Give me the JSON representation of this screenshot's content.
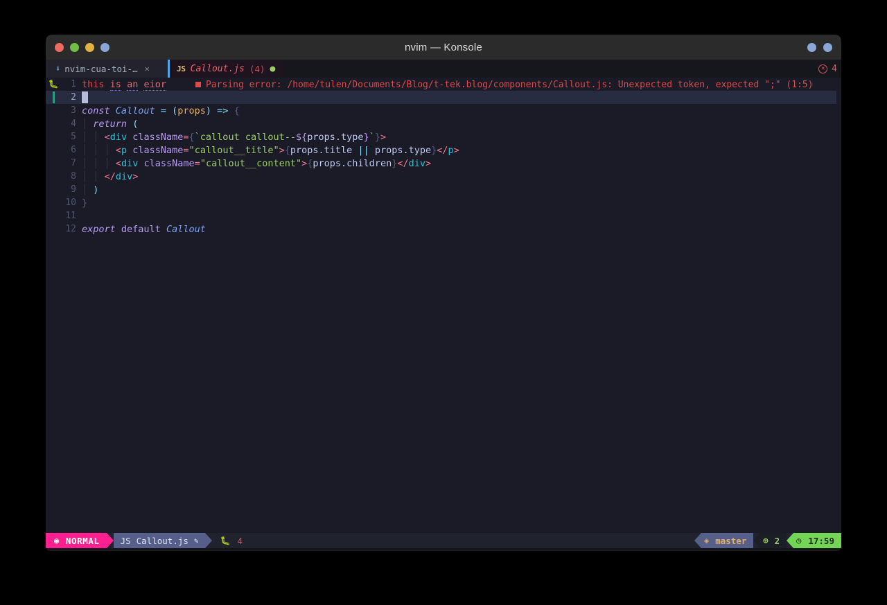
{
  "window": {
    "title": "nvim — Konsole",
    "traffic_lights": [
      "close",
      "minimize",
      "maximize",
      "extra"
    ],
    "colors": {
      "close": "#ec6a5f",
      "minimize": "#71bd45",
      "maximize": "#e3b341",
      "extra": "#89a8d8",
      "titlebar_bg": "#2b2b2b",
      "editor_bg": "#1a1b26",
      "cursorline_bg": "#272c40",
      "mode_bg": "#ff1f8f",
      "time_bg": "#73d455",
      "error_red": "#db4b4b"
    },
    "right_buttons": [
      "dot-one",
      "dot-two"
    ]
  },
  "tabbar": {
    "explorer": {
      "icon": "arrow-down-icon",
      "label": "nvim-cua-toi-…",
      "close": "✕"
    },
    "file_tab": {
      "filetype_badge": "JS",
      "filename": "Callout.js",
      "count": "(4)",
      "modified_dot": "●"
    },
    "diagnostics": {
      "icon": "⊗",
      "count": "4"
    }
  },
  "editor": {
    "lines": [
      {
        "num": "1",
        "sign": "bug-icon"
      },
      {
        "num": "2",
        "sign": "added-bar"
      },
      {
        "num": "3",
        "sign": ""
      },
      {
        "num": "4",
        "sign": ""
      },
      {
        "num": "5",
        "sign": ""
      },
      {
        "num": "6",
        "sign": ""
      },
      {
        "num": "7",
        "sign": ""
      },
      {
        "num": "8",
        "sign": ""
      },
      {
        "num": "9",
        "sign": ""
      },
      {
        "num": "10",
        "sign": ""
      },
      {
        "num": "11",
        "sign": ""
      },
      {
        "num": "12",
        "sign": ""
      }
    ],
    "text": {
      "l1": "this is an eior",
      "l1_words": [
        "this",
        "is",
        "an",
        "eior"
      ],
      "l2": "",
      "l3": "const Callout = (props) => {",
      "l4": "  return (",
      "l5": "    <div className={`callout callout--${props.type}`}>",
      "l6": "      <p className=\"callout__title\">{props.title || props.type}</p>",
      "l7": "      <div className=\"callout__content\">{props.children}</div>",
      "l8": "    </div>",
      "l9": "  )",
      "l10": "}",
      "l11": "",
      "l12": "export default Callout"
    },
    "diagnostic_inline": "Parsing error: /home/tulen/Documents/Blog/t-tek.blog/components/Callout.js: Unexpected token, expected \";\" (1:5)"
  },
  "statusline": {
    "mode_icon": "◉",
    "mode": "NORMAL",
    "filetype": "JS",
    "filename": "Callout.js",
    "modified_icon": "✎",
    "diag_bug_icon": "bug",
    "diag_count": "4",
    "branch_icon": "◈",
    "branch": "master",
    "git_icon": "⊕",
    "git_count": "2",
    "clock_icon": "◷",
    "time": "17:59"
  }
}
